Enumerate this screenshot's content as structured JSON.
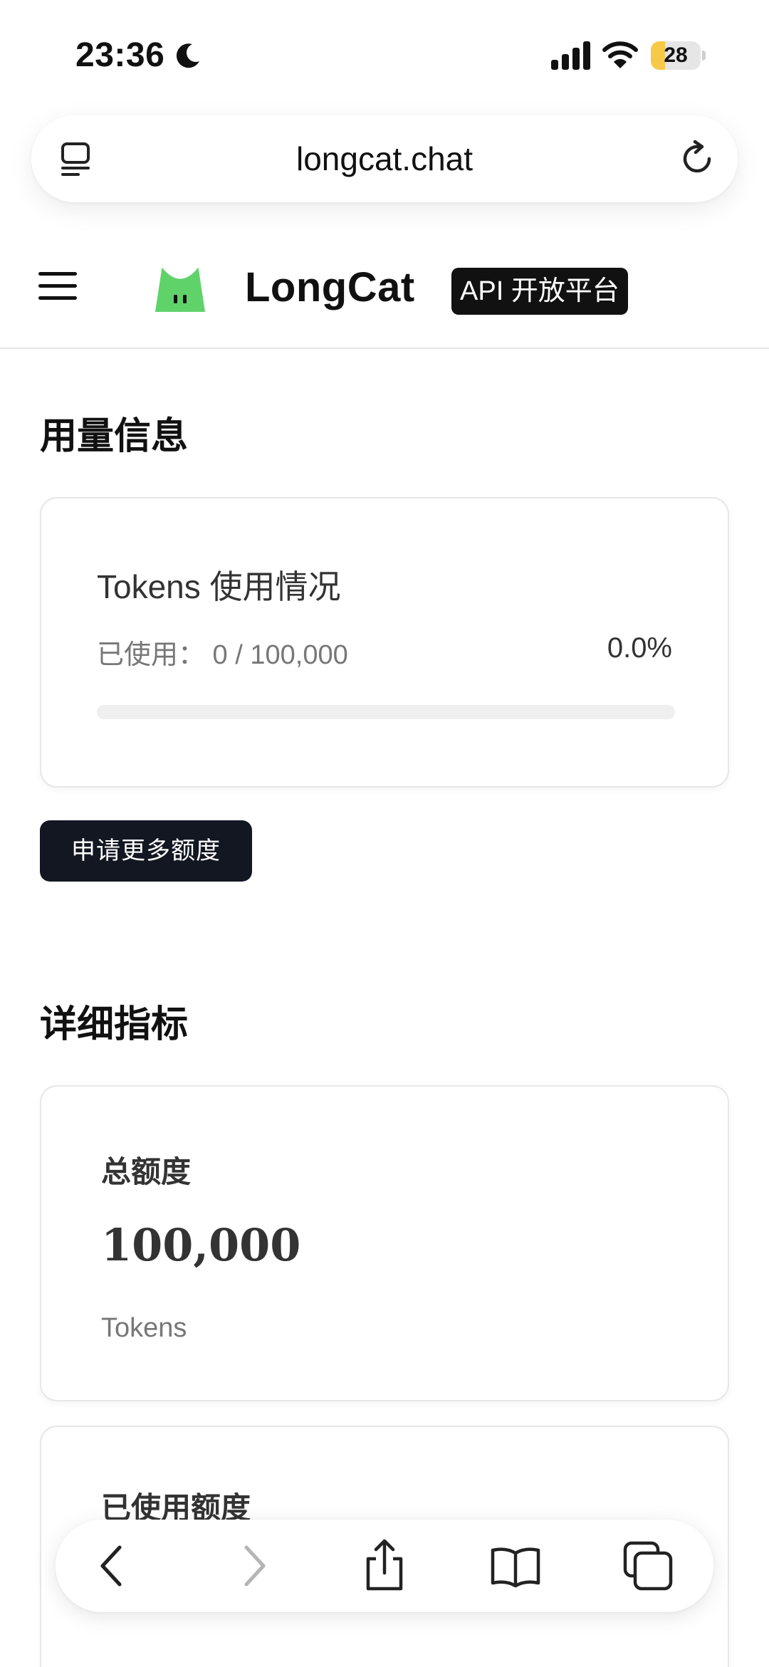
{
  "status_bar": {
    "time": "23:36",
    "battery": "28",
    "battery_level": 0.28
  },
  "browser": {
    "url": "longcat.chat"
  },
  "header": {
    "brand": "LongCat",
    "badge": "API 开放平台"
  },
  "usage_section": {
    "title": "用量信息",
    "card": {
      "title": "Tokens 使用情况",
      "used_text": "已使用：  0 / 100,000",
      "percent": "0.0%",
      "progress": 0.0
    },
    "request_button": "申请更多额度"
  },
  "metrics_section": {
    "title": "详细指标",
    "total": {
      "label": "总额度",
      "value": "100,000",
      "unit": "Tokens"
    },
    "used": {
      "label": "已使用额度"
    }
  },
  "icons": {
    "status": [
      "moon-icon",
      "signal-icon",
      "wifi-icon",
      "battery-icon"
    ],
    "address_bar": [
      "reader-icon",
      "reload-icon"
    ],
    "toolbar": [
      "back-icon",
      "forward-icon",
      "share-icon",
      "bookmarks-icon",
      "tabs-icon"
    ]
  },
  "colors": {
    "logo_green": "#5fd36a",
    "button_dark": "#131722",
    "badge_bg": "#111111"
  }
}
